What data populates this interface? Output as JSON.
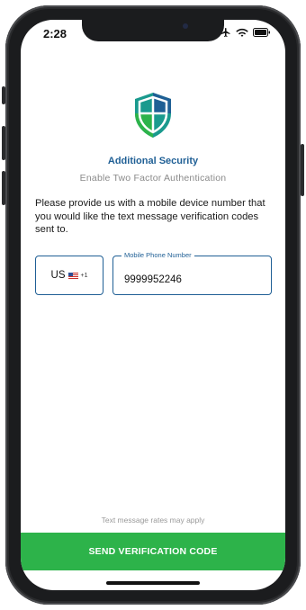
{
  "status_bar": {
    "time": "2:28",
    "icons": [
      "airplane-icon",
      "wifi-icon",
      "battery-icon"
    ]
  },
  "header": {
    "icon": "shield-icon",
    "title": "Additional Security",
    "subtitle": "Enable Two Factor Authentication"
  },
  "instructions": "Please provide us with a mobile device number that you would like the text message verification codes sent to.",
  "country_selector": {
    "code": "US",
    "flag_icon": "us-flag-icon",
    "dial_code": "+1"
  },
  "phone_input": {
    "label": "Mobile Phone Number",
    "value": "9999952246"
  },
  "footer": {
    "note": "Text message rates may apply",
    "button_label": "SEND VERIFICATION CODE"
  },
  "colors": {
    "accent_blue": "#1f5f95",
    "button_green": "#2db34a",
    "shield_teal": "#1a9a8e",
    "shield_green": "#2db34a"
  }
}
